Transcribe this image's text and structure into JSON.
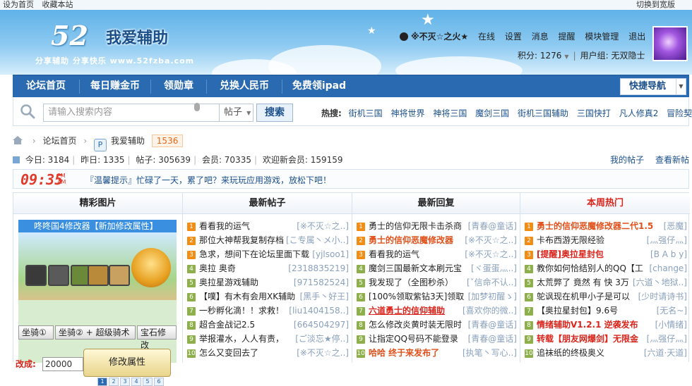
{
  "topbar": {
    "set_home": "设为首页",
    "bookmark": "收藏本站",
    "switch_width": "切换到宽版"
  },
  "logo": {
    "number": "52",
    "name": "我爱辅助",
    "slogan": "分享辅助  分享快乐  www.52fzba.com"
  },
  "user": {
    "name": "※不灭☆之火★",
    "status": "在线",
    "links": [
      "设置",
      "消息",
      "提醒",
      "模块管理",
      "退出"
    ],
    "points": "积分: 1276",
    "group": "用户组: 无双隐士"
  },
  "nav": {
    "items": [
      "论坛首页",
      "每日赚金币",
      "领勋章",
      "兑换人民币",
      "免费领ipad"
    ],
    "quick_nav": "快捷导航"
  },
  "search": {
    "placeholder": "请输入搜索内容",
    "category": "帖子",
    "button": "搜索",
    "hot_label": "热搜:",
    "hot_terms": [
      "街机三国",
      "神将世界",
      "神将三国",
      "魔剑三国",
      "街机三国辅助",
      "三国快打",
      "凡人修真2",
      "冒险契约"
    ]
  },
  "breadcrumb": {
    "home": "论坛首页",
    "forum": "我爱辅助",
    "count": "1536"
  },
  "stats": {
    "today": "今日: 3184",
    "yesterday": "昨日: 1335",
    "posts": "帖子: 305639",
    "members": "会员: 70335",
    "welcome": "欢迎新会员: 159159",
    "my_posts": "我的帖子",
    "view_new": "查看新帖"
  },
  "notice": {
    "clock": "09:35",
    "ampm_top": "PM",
    "ampm_bottom": "AM",
    "message": "『温馨提示』忙碌了一天，累了吧？来玩玩应用游戏，放松下吧！"
  },
  "columns": {
    "pictures": {
      "title": "精彩图片",
      "caption": "咚咚国4修改器【新加修改属性】",
      "skills": [
        "坐骑①",
        "坐骑② + 超级骑术",
        "宝石修改"
      ],
      "gold_label": "改成:",
      "gold_value": "20000",
      "modify_button": "修改属性",
      "pages": [
        "1",
        "2",
        "3",
        "4",
        "5",
        "6"
      ]
    },
    "new_posts": {
      "title": "最新帖子",
      "rows": [
        {
          "n": "1",
          "title": "看看我的运气",
          "user": "[※不灭☆之..]"
        },
        {
          "n": "2",
          "title": "那位大神帮我复制存档",
          "user": "[こ专属丶メ小..]"
        },
        {
          "n": "3",
          "title": "急求，想间下在论坛里面下载",
          "user": "[yjlsoo1]"
        },
        {
          "n": "4",
          "title": "奥拉 奥奇",
          "user": "[2318835219]"
        },
        {
          "n": "5",
          "title": "奥拉星游戏辅助",
          "user": "[971582524]"
        },
        {
          "n": "6",
          "title": "【噗】有木有会用XK辅助",
          "user": "[黑手丶好王]"
        },
        {
          "n": "7",
          "title": "一秒孵化滴！！求救！",
          "user": "[liu1404158..]"
        },
        {
          "n": "8",
          "title": "超合金战记2.5",
          "user": "[664504297]"
        },
        {
          "n": "9",
          "title": "举报灌水，人人有责，",
          "user": "[ご淡忘★停..]"
        },
        {
          "n": "10",
          "title": "怎么又变回去了",
          "user": "[※不灭☆之..]"
        }
      ]
    },
    "latest_replies": {
      "title": "最新回复",
      "rows": [
        {
          "n": "1",
          "title": "勇士的信仰无限卡击杀商",
          "user": "[青春@童话]",
          "style": ""
        },
        {
          "n": "2",
          "title": "勇士的信仰恶魔修改器",
          "user": "[※不灭☆之..]",
          "style": "ored"
        },
        {
          "n": "3",
          "title": "看看我的运气",
          "user": "[※不灭☆之..]",
          "style": ""
        },
        {
          "n": "4",
          "title": "魔剑三国最新文本刷元宝",
          "user": "[ヾ蛋蛋灬..]",
          "style": ""
        },
        {
          "n": "5",
          "title": "我发现了（全图秒杀）",
          "user": "[ˇ信命不认..]",
          "style": ""
        },
        {
          "n": "6",
          "title": "[100%领取紫钻3天]领取",
          "user": "[加梦初醒ゝ]",
          "style": ""
        },
        {
          "n": "7",
          "title": "六道勇士的信仰辅助",
          "user": "[喜欢你的微..]",
          "style": "ul"
        },
        {
          "n": "8",
          "title": "怎么修改炎黄时装无限时",
          "user": "[青春@童话]",
          "style": ""
        },
        {
          "n": "9",
          "title": "让指定QQ号码不能登录",
          "user": "[青春@童话]",
          "style": ""
        },
        {
          "n": "10",
          "title": "哈哈 终于来发布了",
          "user": "[执笔丶写心..]",
          "style": "ored"
        }
      ]
    },
    "weekly_hot": {
      "title": "本周热门",
      "rows": [
        {
          "n": "1",
          "title": "勇士的信仰恶魔修改器二代1.5",
          "user": "[恶魔]",
          "style": "ored"
        },
        {
          "n": "2",
          "title": "卡布西游无限经验",
          "user": "[灬强仔灬]",
          "style": ""
        },
        {
          "n": "3",
          "title": "[提醒]奥拉星封包",
          "user": "[B A b y]",
          "style": "red"
        },
        {
          "n": "4",
          "title": "教你如何恰结别人的QQ【工",
          "user": "[change]",
          "style": ""
        },
        {
          "n": "5",
          "title": "太荒弊了 竟然 有 快 3万",
          "user": "[六道丶地狱..]",
          "style": ""
        },
        {
          "n": "6",
          "title": "鸵讽现在机甲小子是可以",
          "user": "[少时请诗书]",
          "style": ""
        },
        {
          "n": "7",
          "title": "【奥拉星封包】9.6号",
          "user": "[无名~]",
          "style": ""
        },
        {
          "n": "8",
          "title": "情绪辅助V1.2.1 逆袭发布",
          "user": "[小情绪]",
          "style": "red"
        },
        {
          "n": "9",
          "title": "转载【朋友网爆剑】无限金",
          "user": "[灬强仔灬]",
          "style": "red"
        },
        {
          "n": "10",
          "title": "追袜纸的终极奥义",
          "user": "[六道·天道]",
          "style": ""
        }
      ]
    }
  },
  "colors": {
    "nav_bg": "#2a6ab0",
    "accent": "#1a4f8a",
    "hot_red": "#d9251c",
    "rank_orange": "#f28c13",
    "rank_green": "#8eb04a"
  }
}
